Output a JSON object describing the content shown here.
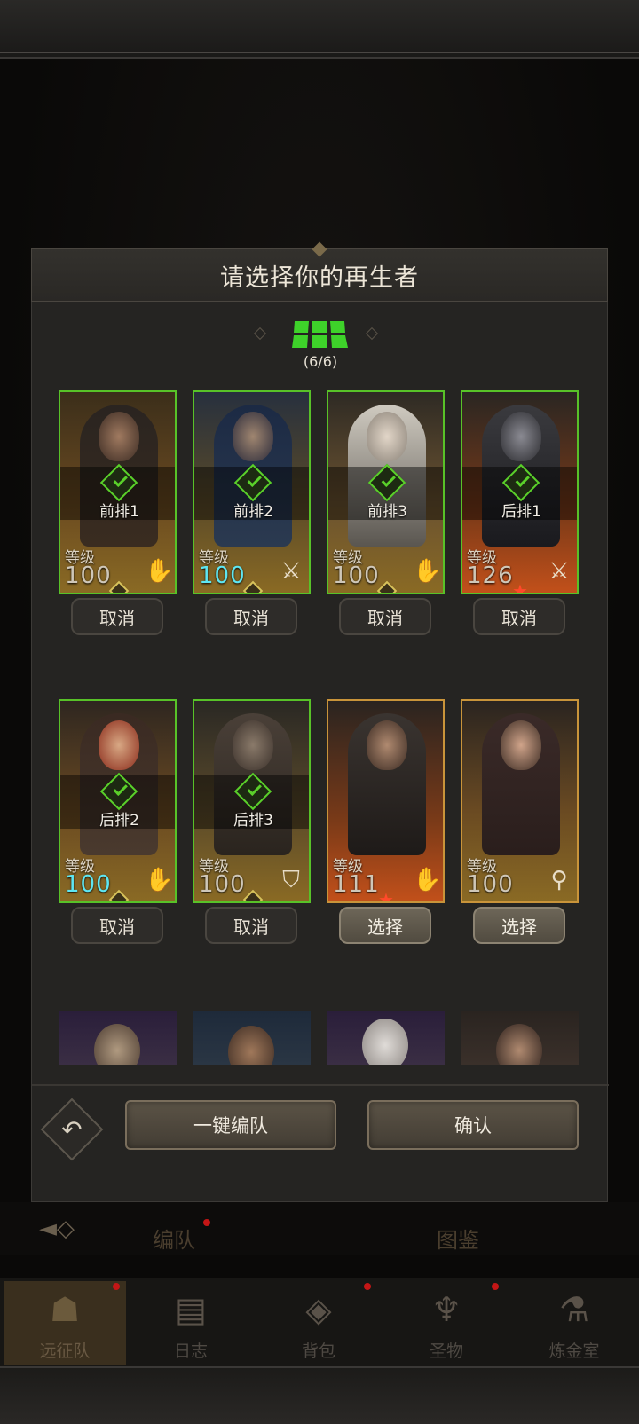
{
  "modal": {
    "title": "请选择你的再生者",
    "team_count": "(6/6)",
    "one_click_label": "一键编队",
    "confirm_label": "确认"
  },
  "heroes": [
    {
      "position": "前排1",
      "level_label": "等级",
      "level": "100",
      "class_icon": "palm-icon",
      "selected": true,
      "button": "取消"
    },
    {
      "position": "前排2",
      "level_label": "等级",
      "level": "100",
      "class_icon": "sword-icon",
      "selected": true,
      "button": "取消"
    },
    {
      "position": "前排3",
      "level_label": "等级",
      "level": "100",
      "class_icon": "palm-icon",
      "selected": true,
      "button": "取消"
    },
    {
      "position": "后排1",
      "level_label": "等级",
      "level": "126",
      "class_icon": "sword-icon",
      "selected": true,
      "button": "取消"
    },
    {
      "position": "后排2",
      "level_label": "等级",
      "level": "100",
      "class_icon": "palm-icon",
      "selected": true,
      "button": "取消"
    },
    {
      "position": "后排3",
      "level_label": "等级",
      "level": "100",
      "class_icon": "shield-icon",
      "selected": true,
      "button": "取消"
    },
    {
      "position": "",
      "level_label": "等级",
      "level": "111",
      "class_icon": "palm-icon",
      "selected": false,
      "button": "选择"
    },
    {
      "position": "",
      "level_label": "等级",
      "level": "100",
      "class_icon": "staff-icon",
      "selected": false,
      "button": "选择"
    }
  ],
  "tabs": {
    "formation": "编队",
    "codex": "图鉴"
  },
  "nav": [
    {
      "label": "远征队",
      "icon": "helmet-icon"
    },
    {
      "label": "日志",
      "icon": "scroll-icon"
    },
    {
      "label": "背包",
      "icon": "bag-icon"
    },
    {
      "label": "圣物",
      "icon": "chalice-icon"
    },
    {
      "label": "炼金室",
      "icon": "alchemy-icon"
    }
  ],
  "colors": {
    "selected_border": "#58c228",
    "check_green": "#5ad02a",
    "level_cyan": "#5ee6f2",
    "badge_red": "#c41616"
  }
}
